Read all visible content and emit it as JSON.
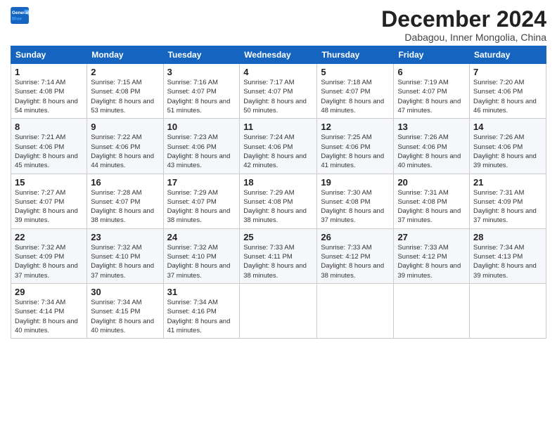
{
  "header": {
    "logo_line1": "General",
    "logo_line2": "Blue",
    "month_title": "December 2024",
    "subtitle": "Dabagou, Inner Mongolia, China"
  },
  "weekdays": [
    "Sunday",
    "Monday",
    "Tuesday",
    "Wednesday",
    "Thursday",
    "Friday",
    "Saturday"
  ],
  "weeks": [
    [
      {
        "day": "1",
        "sunrise": "Sunrise: 7:14 AM",
        "sunset": "Sunset: 4:08 PM",
        "daylight": "Daylight: 8 hours and 54 minutes."
      },
      {
        "day": "2",
        "sunrise": "Sunrise: 7:15 AM",
        "sunset": "Sunset: 4:08 PM",
        "daylight": "Daylight: 8 hours and 53 minutes."
      },
      {
        "day": "3",
        "sunrise": "Sunrise: 7:16 AM",
        "sunset": "Sunset: 4:07 PM",
        "daylight": "Daylight: 8 hours and 51 minutes."
      },
      {
        "day": "4",
        "sunrise": "Sunrise: 7:17 AM",
        "sunset": "Sunset: 4:07 PM",
        "daylight": "Daylight: 8 hours and 50 minutes."
      },
      {
        "day": "5",
        "sunrise": "Sunrise: 7:18 AM",
        "sunset": "Sunset: 4:07 PM",
        "daylight": "Daylight: 8 hours and 48 minutes."
      },
      {
        "day": "6",
        "sunrise": "Sunrise: 7:19 AM",
        "sunset": "Sunset: 4:07 PM",
        "daylight": "Daylight: 8 hours and 47 minutes."
      },
      {
        "day": "7",
        "sunrise": "Sunrise: 7:20 AM",
        "sunset": "Sunset: 4:06 PM",
        "daylight": "Daylight: 8 hours and 46 minutes."
      }
    ],
    [
      {
        "day": "8",
        "sunrise": "Sunrise: 7:21 AM",
        "sunset": "Sunset: 4:06 PM",
        "daylight": "Daylight: 8 hours and 45 minutes."
      },
      {
        "day": "9",
        "sunrise": "Sunrise: 7:22 AM",
        "sunset": "Sunset: 4:06 PM",
        "daylight": "Daylight: 8 hours and 44 minutes."
      },
      {
        "day": "10",
        "sunrise": "Sunrise: 7:23 AM",
        "sunset": "Sunset: 4:06 PM",
        "daylight": "Daylight: 8 hours and 43 minutes."
      },
      {
        "day": "11",
        "sunrise": "Sunrise: 7:24 AM",
        "sunset": "Sunset: 4:06 PM",
        "daylight": "Daylight: 8 hours and 42 minutes."
      },
      {
        "day": "12",
        "sunrise": "Sunrise: 7:25 AM",
        "sunset": "Sunset: 4:06 PM",
        "daylight": "Daylight: 8 hours and 41 minutes."
      },
      {
        "day": "13",
        "sunrise": "Sunrise: 7:26 AM",
        "sunset": "Sunset: 4:06 PM",
        "daylight": "Daylight: 8 hours and 40 minutes."
      },
      {
        "day": "14",
        "sunrise": "Sunrise: 7:26 AM",
        "sunset": "Sunset: 4:06 PM",
        "daylight": "Daylight: 8 hours and 39 minutes."
      }
    ],
    [
      {
        "day": "15",
        "sunrise": "Sunrise: 7:27 AM",
        "sunset": "Sunset: 4:07 PM",
        "daylight": "Daylight: 8 hours and 39 minutes."
      },
      {
        "day": "16",
        "sunrise": "Sunrise: 7:28 AM",
        "sunset": "Sunset: 4:07 PM",
        "daylight": "Daylight: 8 hours and 38 minutes."
      },
      {
        "day": "17",
        "sunrise": "Sunrise: 7:29 AM",
        "sunset": "Sunset: 4:07 PM",
        "daylight": "Daylight: 8 hours and 38 minutes."
      },
      {
        "day": "18",
        "sunrise": "Sunrise: 7:29 AM",
        "sunset": "Sunset: 4:08 PM",
        "daylight": "Daylight: 8 hours and 38 minutes."
      },
      {
        "day": "19",
        "sunrise": "Sunrise: 7:30 AM",
        "sunset": "Sunset: 4:08 PM",
        "daylight": "Daylight: 8 hours and 37 minutes."
      },
      {
        "day": "20",
        "sunrise": "Sunrise: 7:31 AM",
        "sunset": "Sunset: 4:08 PM",
        "daylight": "Daylight: 8 hours and 37 minutes."
      },
      {
        "day": "21",
        "sunrise": "Sunrise: 7:31 AM",
        "sunset": "Sunset: 4:09 PM",
        "daylight": "Daylight: 8 hours and 37 minutes."
      }
    ],
    [
      {
        "day": "22",
        "sunrise": "Sunrise: 7:32 AM",
        "sunset": "Sunset: 4:09 PM",
        "daylight": "Daylight: 8 hours and 37 minutes."
      },
      {
        "day": "23",
        "sunrise": "Sunrise: 7:32 AM",
        "sunset": "Sunset: 4:10 PM",
        "daylight": "Daylight: 8 hours and 37 minutes."
      },
      {
        "day": "24",
        "sunrise": "Sunrise: 7:32 AM",
        "sunset": "Sunset: 4:10 PM",
        "daylight": "Daylight: 8 hours and 37 minutes."
      },
      {
        "day": "25",
        "sunrise": "Sunrise: 7:33 AM",
        "sunset": "Sunset: 4:11 PM",
        "daylight": "Daylight: 8 hours and 38 minutes."
      },
      {
        "day": "26",
        "sunrise": "Sunrise: 7:33 AM",
        "sunset": "Sunset: 4:12 PM",
        "daylight": "Daylight: 8 hours and 38 minutes."
      },
      {
        "day": "27",
        "sunrise": "Sunrise: 7:33 AM",
        "sunset": "Sunset: 4:12 PM",
        "daylight": "Daylight: 8 hours and 39 minutes."
      },
      {
        "day": "28",
        "sunrise": "Sunrise: 7:34 AM",
        "sunset": "Sunset: 4:13 PM",
        "daylight": "Daylight: 8 hours and 39 minutes."
      }
    ],
    [
      {
        "day": "29",
        "sunrise": "Sunrise: 7:34 AM",
        "sunset": "Sunset: 4:14 PM",
        "daylight": "Daylight: 8 hours and 40 minutes."
      },
      {
        "day": "30",
        "sunrise": "Sunrise: 7:34 AM",
        "sunset": "Sunset: 4:15 PM",
        "daylight": "Daylight: 8 hours and 40 minutes."
      },
      {
        "day": "31",
        "sunrise": "Sunrise: 7:34 AM",
        "sunset": "Sunset: 4:16 PM",
        "daylight": "Daylight: 8 hours and 41 minutes."
      },
      null,
      null,
      null,
      null
    ]
  ]
}
